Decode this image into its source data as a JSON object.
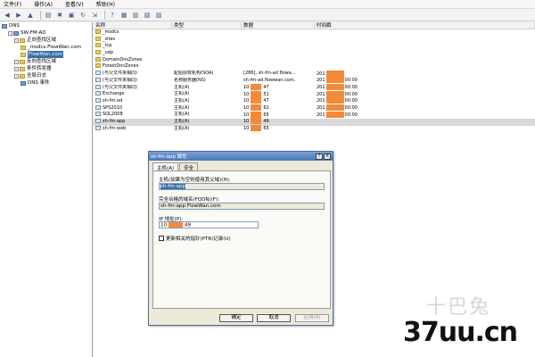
{
  "menu": [
    "文件(F)",
    "操作(A)",
    "查看(V)",
    "帮助(H)"
  ],
  "toolbar_icons": [
    "back-icon",
    "forward-icon",
    "up-icon",
    "show-tree-icon",
    "delete-icon",
    "properties-icon",
    "refresh-icon",
    "export-icon",
    "help-icon",
    "new-record-icon",
    "new-zone-icon",
    "new-host-icon",
    "new-alias-icon"
  ],
  "tree": [
    {
      "label": "DNS",
      "level": 0,
      "icon": "srv"
    },
    {
      "label": "SW-FM-AD",
      "level": 1,
      "icon": "srv"
    },
    {
      "label": "正向查找区域",
      "level": 2,
      "icon": "fold"
    },
    {
      "label": "_msdcs.FlowWan.com",
      "level": 3,
      "icon": "fold"
    },
    {
      "label": "FlowWan.com",
      "level": 3,
      "icon": "fold",
      "selected": true
    },
    {
      "label": "反向查找区域",
      "level": 2,
      "icon": "fold"
    },
    {
      "label": "条件转发器",
      "level": 2,
      "icon": "fold"
    },
    {
      "label": "全局日志",
      "level": 2,
      "icon": "fold"
    },
    {
      "label": "DNS 事件",
      "level": 3,
      "icon": "srv"
    }
  ],
  "list": {
    "columns": [
      "名称",
      "类型",
      "数据",
      "时间戳"
    ],
    "rows": [
      {
        "name": "_msdcs",
        "type": "",
        "data": "",
        "ts": "",
        "icon": "fold"
      },
      {
        "name": "_sites",
        "type": "",
        "data": "",
        "ts": "",
        "icon": "fold"
      },
      {
        "name": "_tcp",
        "type": "",
        "data": "",
        "ts": "",
        "icon": "fold"
      },
      {
        "name": "_udp",
        "type": "",
        "data": "",
        "ts": "",
        "icon": "fold"
      },
      {
        "name": "DomainDnsZones",
        "type": "",
        "data": "",
        "ts": "",
        "icon": "fold"
      },
      {
        "name": "ForestDnsZones",
        "type": "",
        "data": "",
        "ts": "",
        "icon": "fold"
      },
      {
        "name": "(与父文件夹相同)",
        "type": "起始授权机构(SOA)",
        "data": "[286], sh-fm-ad flowa...",
        "ts": "201",
        "ts_end": "",
        "icon": "rec"
      },
      {
        "name": "(与父文件夹相同)",
        "type": "名称服务器(NS)",
        "data": "sh-fm-ad.flowwan.com.",
        "ts": "201",
        "ts_end": "00:00",
        "icon": "rec"
      },
      {
        "name": "(与父文件夹相同)",
        "type": "主机(A)",
        "data": "10",
        "data_end": "47",
        "ts": "201",
        "ts_end": "00:00",
        "icon": "rec"
      },
      {
        "name": "Exchange",
        "type": "主机(A)",
        "data": "10",
        "data_end": "51",
        "ts": "201",
        "ts_end": "00:00",
        "icon": "rec"
      },
      {
        "name": "sh-fm-ad",
        "type": "主机(A)",
        "data": "10",
        "data_end": "47",
        "ts": "201",
        "ts_end": "00:00",
        "icon": "rec"
      },
      {
        "name": "SPS2010",
        "type": "主机(A)",
        "data": "10",
        "data_end": "62",
        "ts": "201",
        "ts_end": "00:00",
        "icon": "rec"
      },
      {
        "name": "SQL2008",
        "type": "主机(A)",
        "data": "10",
        "data_end": "65",
        "ts": "201",
        "ts_end": "00:00",
        "icon": "rec"
      },
      {
        "name": "sh-fm-app",
        "type": "主机(A)",
        "data": "10",
        "data_end": "49",
        "ts": "",
        "ts_end": "",
        "icon": "rec",
        "selected": true
      },
      {
        "name": "sh-fm-web",
        "type": "主机(A)",
        "data": "10",
        "data_end": "65",
        "ts": "",
        "ts_end": "",
        "icon": "rec"
      }
    ]
  },
  "dialog": {
    "title": "sh-fm-app 属性",
    "title_buttons": [
      "?",
      "X"
    ],
    "tabs": [
      "主机(A)",
      "安全"
    ],
    "host_label": "主机(如果为空则使用其父域)(H):",
    "host_value": "sh-fm-app",
    "fqdn_label": "完全合格的域名(FQDN)(F):",
    "fqdn_value": "sh-fm-app.FlowWan.com",
    "ip_label": "IP 地址(P):",
    "ip_start": "10",
    "ip_end": "49",
    "ptr_label": "更新相关的指针(PTR)记录(U)",
    "ok": "确定",
    "cancel": "取消",
    "apply": "应用(A)"
  },
  "watermark_top": "十巴兔",
  "watermark": "37uu.cn",
  "mask_color": "#f28a3a"
}
